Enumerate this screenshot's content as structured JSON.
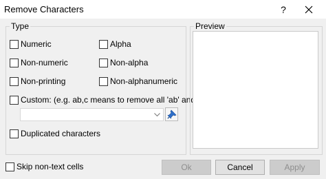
{
  "window": {
    "title": "Remove Characters"
  },
  "titlebar": {
    "help_label": "?"
  },
  "type_group": {
    "label": "Type",
    "options": {
      "numeric": "Numeric",
      "alpha": "Alpha",
      "non_numeric": "Non-numeric",
      "non_alpha": "Non-alpha",
      "non_printing": "Non-printing",
      "non_alphanumeric": "Non-alphanumeric",
      "custom": "Custom: (e.g. ab,c means to remove all 'ab' and 'c')",
      "duplicated": "Duplicated characters"
    },
    "custom_value": ""
  },
  "preview_group": {
    "label": "Preview"
  },
  "footer": {
    "skip_non_text": "Skip non-text cells",
    "ok_label": "Ok",
    "cancel_label": "Cancel",
    "apply_label": "Apply"
  },
  "colors": {
    "pin_icon": "#2e6fc9",
    "border": "#d5d5d5",
    "disabled_button": "#cccccc"
  },
  "icons": {
    "close": "close-icon",
    "dropdown": "chevron-down-icon",
    "pin": "pin-icon"
  }
}
